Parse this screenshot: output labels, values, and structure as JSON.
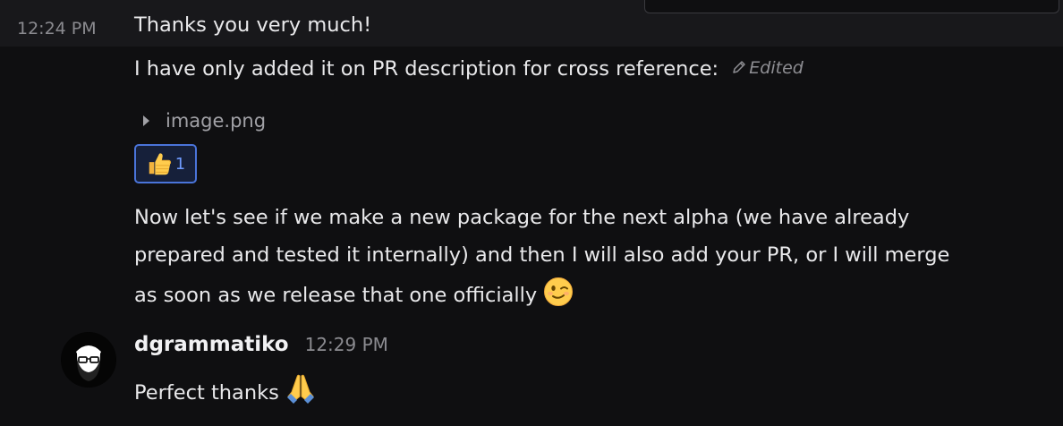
{
  "messages": [
    {
      "timestamp": "12:24 PM",
      "text": "Thanks you very much!"
    },
    {
      "text": "I have only added it on PR description for cross reference:",
      "edited_label": "Edited",
      "attachment": {
        "filename": "image.png"
      },
      "reaction": {
        "emoji_icon": "thumbs-up-icon",
        "count": "1"
      }
    },
    {
      "lines": [
        "Now let's see if we make a new package for the next alpha (we have already",
        "prepared and tested it internally) and then I will also add your PR, or I will merge",
        "as soon as we release that one officially"
      ],
      "emoji_icon": "winking-face-icon"
    }
  ],
  "reply": {
    "author": "dgrammatiko",
    "timestamp": "12:29 PM",
    "text": "Perfect thanks",
    "emoji_icon": "folded-hands-icon",
    "avatar_icon": "bearded-man-avatar-icon"
  },
  "colors": {
    "background": "#0f0f11",
    "hover_row": "#18181b",
    "reaction_border": "#4a74d9",
    "reaction_count": "#6f9bff",
    "muted_text": "#8b8b90"
  }
}
